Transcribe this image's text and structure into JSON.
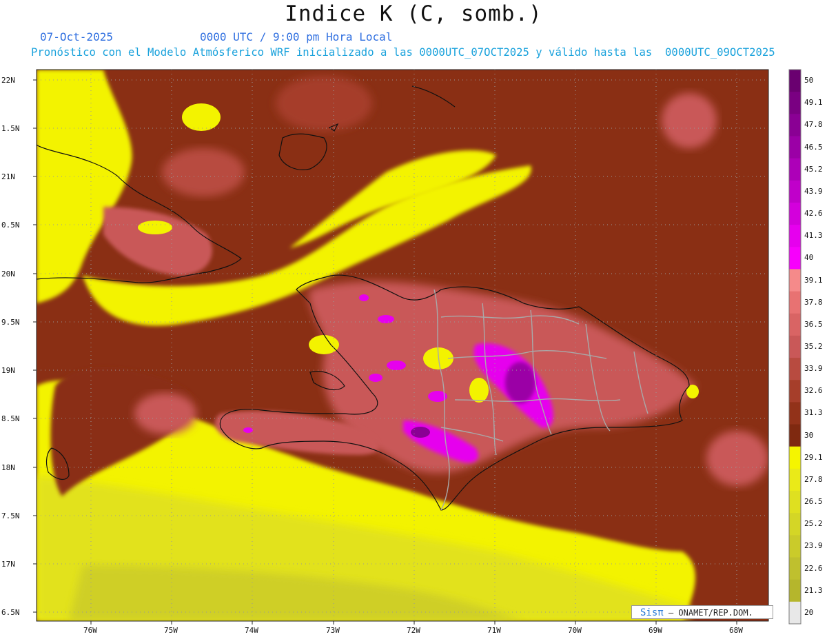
{
  "header": {
    "title": "Indice K (C, somb.)",
    "date": "07-Oct-2025",
    "time": "0000 UTC / 9:00 pm Hora Local",
    "description": "Pronóstico con el Modelo Atmósferico WRF inicializado a las 0000UTC_07OCT2025 y válido hasta las  0000UTC_09OCT2025"
  },
  "axes": {
    "lat_labels": [
      "22N",
      "1.5N",
      "21N",
      "0.5N",
      "20N",
      "9.5N",
      "19N",
      "8.5N",
      "18N",
      "7.5N",
      "17N",
      "6.5N"
    ],
    "lon_labels": [
      "76W",
      "75W",
      "74W",
      "73W",
      "72W",
      "71W",
      "70W",
      "69W",
      "68W"
    ]
  },
  "colorbar": {
    "labels": [
      "50",
      "49.1",
      "47.8",
      "46.5",
      "45.2",
      "43.9",
      "42.6",
      "41.3",
      "40",
      "39.1",
      "37.8",
      "36.5",
      "35.2",
      "33.9",
      "32.6",
      "31.3",
      "30",
      "29.1",
      "27.8",
      "26.5",
      "25.2",
      "23.9",
      "22.6",
      "21.3",
      "20"
    ],
    "colors": [
      "#6a0070",
      "#7a0082",
      "#8a0094",
      "#9b00a6",
      "#ad00b8",
      "#c000ca",
      "#d300dc",
      "#e600ee",
      "#f700fc",
      "#f58a8a",
      "#e87272",
      "#d96464",
      "#c95858",
      "#b84b40",
      "#a63e2a",
      "#923219",
      "#7f2910",
      "#f5f500",
      "#eaea18",
      "#dfe020",
      "#d4d626",
      "#cacb2a",
      "#bfc02e",
      "#b5b62c",
      "#e8e8e8"
    ]
  },
  "credit": {
    "brand": "Sisπ",
    "org": " – ONAMET/REP.DOM."
  },
  "colors": {
    "yellow": "#f3f300",
    "brown_dark": "#7f2910",
    "brown_mid": "#a63e2a",
    "salmon": "#c95858",
    "magenta": "#e600ee",
    "purple": "#8a0094"
  }
}
